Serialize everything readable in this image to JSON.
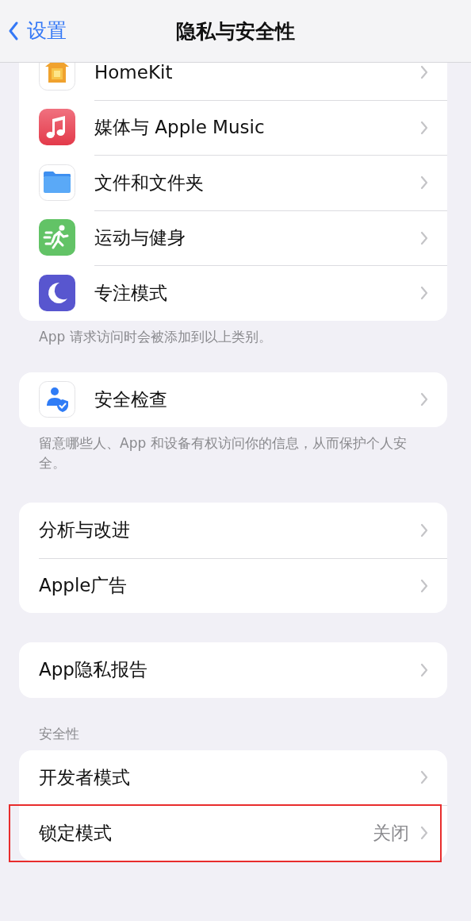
{
  "nav": {
    "back": "设置",
    "title": "隐私与安全性"
  },
  "groups": [
    {
      "rows": [
        {
          "kind": "home",
          "label": "HomeKit"
        },
        {
          "kind": "music",
          "label": "媒体与 Apple Music"
        },
        {
          "kind": "folder",
          "label": "文件和文件夹"
        },
        {
          "kind": "fitness",
          "label": "运动与健身"
        },
        {
          "kind": "focus",
          "label": "专注模式"
        }
      ],
      "footer": "App 请求访问时会被添加到以上类别。"
    },
    {
      "rows": [
        {
          "kind": "safety",
          "label": "安全检查"
        }
      ],
      "footer": "留意哪些人、App 和设备有权访问你的信息，从而保护个人安全。"
    },
    {
      "rows": [
        {
          "kind": "plain",
          "label": "分析与改进"
        },
        {
          "kind": "plain",
          "label": "Apple广告"
        }
      ]
    },
    {
      "rows": [
        {
          "kind": "plain",
          "label": "App隐私报告"
        }
      ]
    },
    {
      "header": "安全性",
      "rows": [
        {
          "kind": "plain",
          "label": "开发者模式"
        },
        {
          "kind": "plain",
          "label": "锁定模式",
          "value": "关闭",
          "highlighted": true
        }
      ]
    }
  ]
}
